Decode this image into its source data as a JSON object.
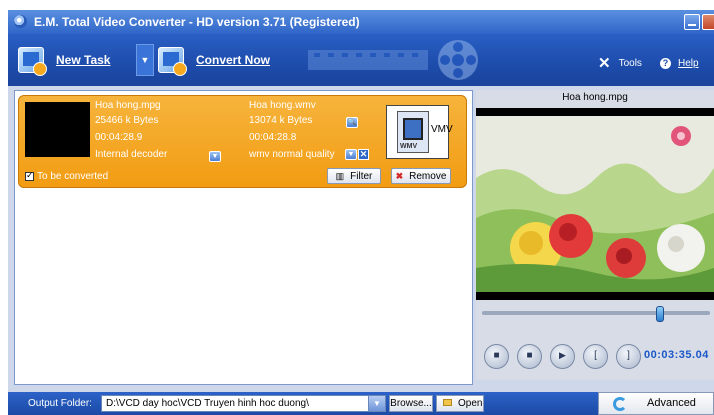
{
  "window": {
    "title": "E.M. Total Video Converter - HD version 3.71 (Registered)"
  },
  "toolbar": {
    "new_task": "New Task",
    "convert_now": "Convert Now",
    "tools": "Tools",
    "help": "Help"
  },
  "task": {
    "source": {
      "name": "Hoa hong.mpg",
      "size": "25466 k Bytes",
      "duration": "00:04:28.9",
      "decoder": "Internal decoder"
    },
    "target": {
      "name": "Hoa hong.wmv",
      "size": "13074 k Bytes",
      "duration": "00:04:28.8",
      "quality": "wmv normal quality",
      "format_tag": "WMV",
      "format_side": "VMV"
    },
    "to_be_converted": "To be converted",
    "filter_button": "Filter",
    "remove_button": "Remove"
  },
  "preview": {
    "title": "Hoa hong.mpg",
    "timecode": "00:03:35.04",
    "position": 0.78
  },
  "bottom": {
    "output_folder_label": "Output Folder:",
    "output_folder_value": "D:\\VCD day hoc\\VCD Truyen hinh hoc duong\\",
    "browse": "Browse...",
    "open": "Open",
    "advanced": "Advanced"
  },
  "colors": {
    "title_blue": "#2f65c8",
    "task_orange": "#f29c12",
    "timecode_blue": "#1b57c9"
  }
}
